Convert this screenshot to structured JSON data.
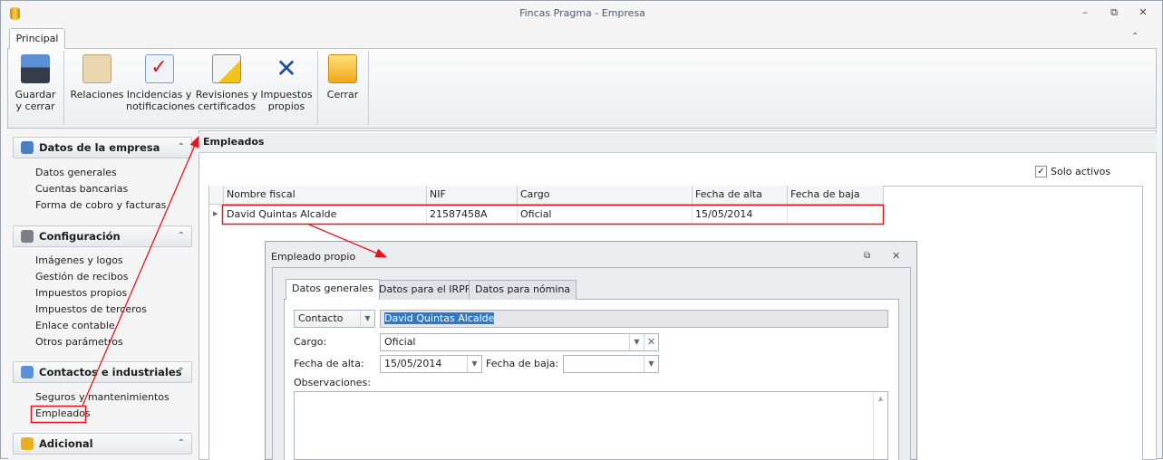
{
  "window": {
    "title": "Fincas Pragma - Empresa",
    "controls": [
      "minimize",
      "restore",
      "close"
    ]
  },
  "ribbon": {
    "tab": "Principal",
    "buttons": [
      {
        "id": "guardar",
        "label": [
          "Guardar",
          "y cerrar"
        ],
        "icon": "floppy-icon"
      },
      {
        "id": "relaciones",
        "label": [
          "Relaciones",
          ""
        ],
        "icon": "contacts-icon"
      },
      {
        "id": "incidencias",
        "label": [
          "Incidencias y",
          "notificaciones"
        ],
        "icon": "mail-check-icon"
      },
      {
        "id": "revisiones",
        "label": [
          "Revisiones y",
          "certificados"
        ],
        "icon": "bell-doc-icon"
      },
      {
        "id": "impuestos",
        "label": [
          "Impuestos",
          "propios"
        ],
        "icon": "tax-agency-icon"
      },
      {
        "id": "cerrar",
        "label": [
          "Cerrar",
          ""
        ],
        "icon": "folder-icon"
      }
    ]
  },
  "sidebar": {
    "groups": [
      {
        "title": "Datos de la empresa",
        "items": [
          "Datos generales",
          "Cuentas bancarias",
          "Forma de cobro y facturas"
        ]
      },
      {
        "title": "Configuración",
        "items": [
          "Imágenes y logos",
          "Gestión de recibos",
          "Impuestos propios",
          "Impuestos de terceros",
          "Enlace contable",
          "Otros parámetros"
        ]
      },
      {
        "title": "Contactos e industriales",
        "items": [
          "Seguros y mantenimientos",
          "Empleados"
        ]
      },
      {
        "title": "Adicional",
        "items": []
      }
    ]
  },
  "main": {
    "title": "Empleados",
    "solo_activos_label": "Solo activos",
    "solo_activos": true,
    "columns": [
      "Nombre fiscal",
      "NIF",
      "Cargo",
      "Fecha de alta",
      "Fecha de baja"
    ],
    "rows": [
      [
        "David Quintas Alcalde",
        "21587458A",
        "Oficial",
        "15/05/2014",
        ""
      ]
    ]
  },
  "dialog": {
    "title": "Empleado propio",
    "tabs": [
      "Datos generales",
      "Datos para el IRPF",
      "Datos para nómina"
    ],
    "contact_type": "Contacto",
    "name": "David Quintas Alcalde",
    "cargo_label": "Cargo:",
    "cargo": "Oficial",
    "fecha_alta_label": "Fecha de alta:",
    "fecha_alta": "15/05/2014",
    "fecha_baja_label": "Fecha de baja:",
    "fecha_baja": "",
    "observaciones_label": "Observaciones:",
    "observaciones": ""
  },
  "colors": {
    "annotation": "#e8141c",
    "selection": "#3178c6"
  }
}
